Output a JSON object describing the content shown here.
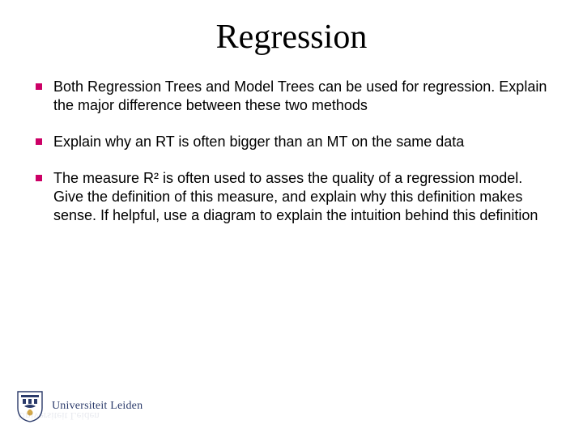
{
  "slide": {
    "title": "Regression",
    "bullets": [
      "Both Regression Trees and Model Trees can be used for regression. Explain the major difference between these two methods",
      "Explain why an RT is often bigger than an MT on the same data",
      "The measure R² is often used to asses the quality of a regression model. Give the definition of this measure, and explain why this definition makes sense. If helpful, use a diagram to explain the intuition behind this definition"
    ]
  },
  "footer": {
    "institution": "Universiteit Leiden",
    "logo_alt": "university-crest"
  },
  "colors": {
    "bullet_marker": "#cc0066",
    "logo_text": "#2a3a6a"
  }
}
